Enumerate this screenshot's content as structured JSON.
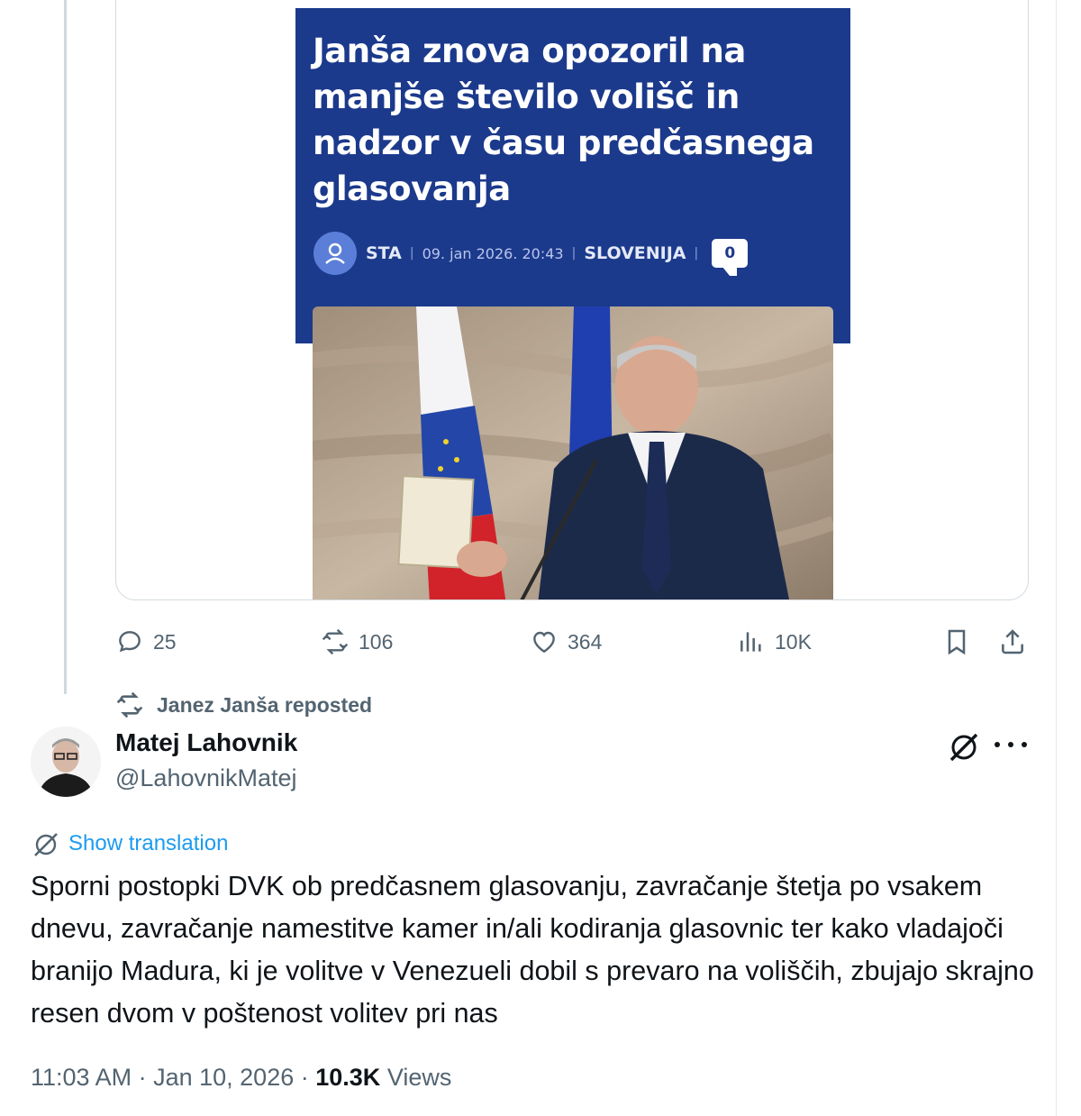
{
  "embedded_article": {
    "headline": "Janša znova opozoril na\nmanjše število volišč in\nnadzor v času predčasnega\nglasovanja",
    "source": "STA",
    "datetime": "09. jan 2026. 20:43",
    "section": "SLOVENIJA",
    "comments": "0"
  },
  "previous_post_actions": {
    "replies": "25",
    "reposts": "106",
    "likes": "364",
    "views": "10K"
  },
  "repost_label": "Janez Janša reposted",
  "post": {
    "display_name": "Matej Lahovnik",
    "handle": "@LahovnikMatej",
    "translate_label": "Show translation",
    "text": "Sporni postopki DVK ob predčasnem glasovanju, zavračanje štetja po vsakem dnevu, zavračanje namestitve kamer in/ali kodiranja glasovnic ter kako vladajoči branijo Madura, ki je volitve v Venezueli dobil s prevaro na voliščih, zbujajo skrajno resen dvom v poštenost volitev pri nas",
    "time": "11:03 AM",
    "date": "Jan 10, 2026",
    "views_count": "10.3K",
    "views_label": "Views"
  },
  "icons": {
    "reply": "reply-icon",
    "repost": "repost-icon",
    "like": "heart-icon",
    "views": "views-icon",
    "bookmark": "bookmark-icon",
    "share": "share-icon",
    "grok": "grok-icon",
    "more": "more-icon"
  },
  "colors": {
    "article_bg": "#1c3a8c",
    "link": "#1d9bf0",
    "muted": "#536471",
    "text": "#0f1419"
  }
}
